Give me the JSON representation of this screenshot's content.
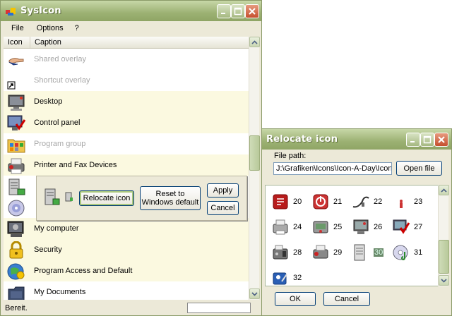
{
  "main_window": {
    "title": "SysIcon",
    "menu": [
      "File",
      "Options",
      "?"
    ],
    "columns": [
      "Icon",
      "Caption"
    ],
    "rows": [
      {
        "caption": "Shared overlay",
        "dim": true,
        "icon": "shared-overlay-icon"
      },
      {
        "caption": "Shortcut overlay",
        "dim": true,
        "icon": "shortcut-overlay-icon"
      },
      {
        "caption": "Desktop",
        "dim": false,
        "icon": "desktop-icon"
      },
      {
        "caption": "Control panel",
        "dim": false,
        "icon": "control-panel-icon"
      },
      {
        "caption": "Program group",
        "dim": true,
        "icon": "program-group-icon"
      },
      {
        "caption": "Printer and Fax Devices",
        "dim": false,
        "icon": "printer-icon"
      },
      {
        "caption": "",
        "dim": false,
        "icon": "server-icon"
      },
      {
        "caption": "",
        "dim": false,
        "icon": "cd-drive-icon"
      },
      {
        "caption": "My computer",
        "dim": false,
        "icon": "my-computer-icon"
      },
      {
        "caption": "Security",
        "dim": false,
        "icon": "lock-icon"
      },
      {
        "caption": "Program Access and Default",
        "dim": false,
        "icon": "program-access-icon"
      },
      {
        "caption": "My Documents",
        "dim": false,
        "icon": "my-documents-icon"
      }
    ],
    "popup": {
      "relocate_label": "Relocate icon",
      "reset_label": "Reset to Windows default",
      "apply_label": "Apply",
      "cancel_label": "Cancel"
    },
    "status": "Bereit."
  },
  "relocate_dialog": {
    "title": "Relocate icon",
    "file_path_label": "File path:",
    "file_path_value": "J:\\Grafiken\\Icons\\Icon-A-Day\\Icon-A-Day",
    "open_file_label": "Open file",
    "icons": [
      {
        "num": "20",
        "icon": "pdf-icon"
      },
      {
        "num": "21",
        "icon": "power-icon"
      },
      {
        "num": "22",
        "icon": "cable-icon"
      },
      {
        "num": "23",
        "icon": "small-figure-icon"
      },
      {
        "num": "24",
        "icon": "printer-icon"
      },
      {
        "num": "25",
        "icon": "scanner-icon"
      },
      {
        "num": "26",
        "icon": "monitor-icon"
      },
      {
        "num": "27",
        "icon": "monitor-check-icon"
      },
      {
        "num": "28",
        "icon": "fax-icon"
      },
      {
        "num": "29",
        "icon": "printer-red-icon"
      },
      {
        "num": "30",
        "icon": "document-icon"
      },
      {
        "num": "31",
        "icon": "cd-music-icon"
      },
      {
        "num": "32",
        "icon": "user-card-icon"
      }
    ],
    "ok_label": "OK",
    "cancel_label": "Cancel"
  },
  "colors": {
    "titlebar": "#9cb173",
    "row_alt": "#fbf9e0",
    "close_button": "#c5502e"
  }
}
